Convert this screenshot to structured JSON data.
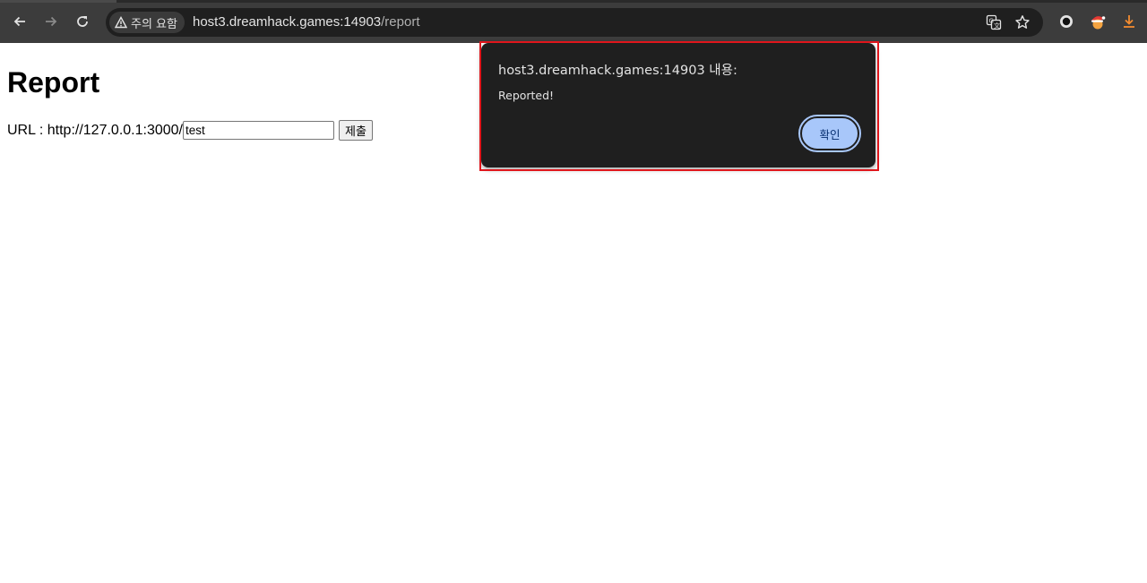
{
  "browser": {
    "security_chip_label": "주의 요함",
    "url_host": "host3.dreamhack.games:14903",
    "url_path": "/report",
    "icons": {
      "back": "arrow-left-icon",
      "forward": "arrow-right-icon",
      "reload": "reload-icon",
      "warning": "warning-triangle-icon",
      "translate": "translate-icon",
      "bookmark": "star-icon",
      "extension_1": "circle-extension-icon",
      "extension_2": "santa-extension-icon",
      "download": "download-icon"
    }
  },
  "page": {
    "title": "Report",
    "form": {
      "label": "URL : http://127.0.0.1:3000/",
      "input_value": "test",
      "submit_label": "제출"
    }
  },
  "alert": {
    "origin": "host3.dreamhack.games:14903 내용:",
    "message": "Reported!",
    "ok_label": "확인",
    "accent_color": "#a8c7fa",
    "highlight_color": "#e0161c"
  }
}
